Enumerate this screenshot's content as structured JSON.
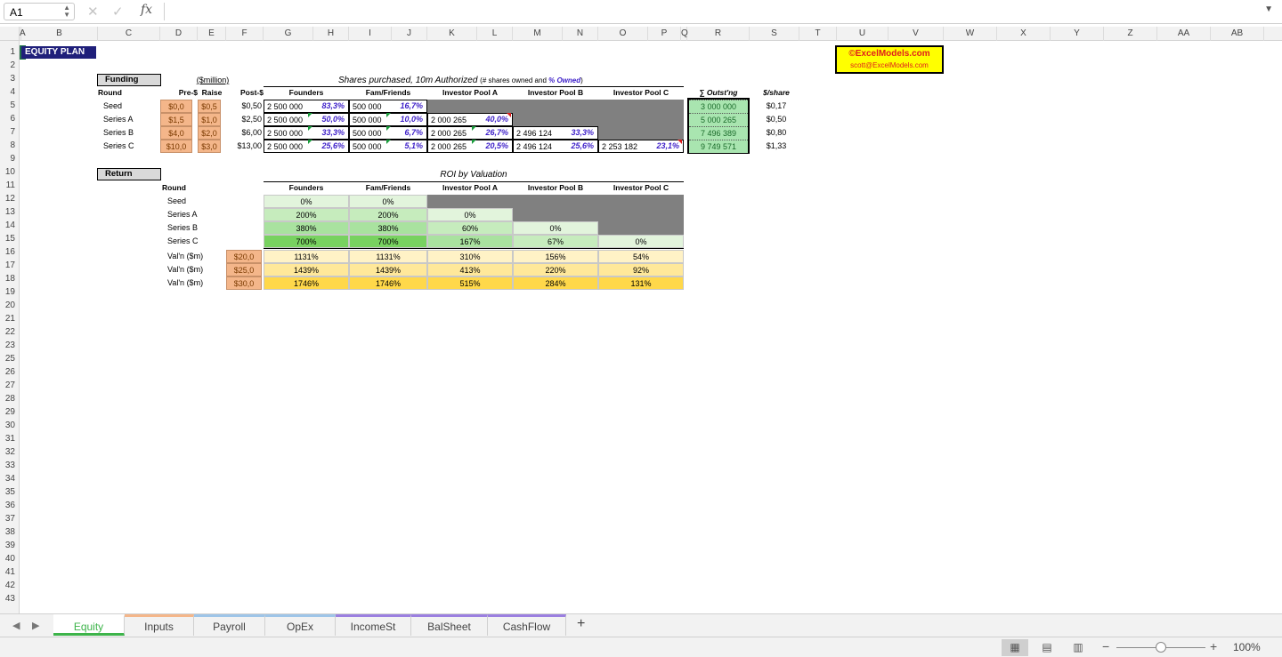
{
  "formula_bar": {
    "cell_ref": "A1",
    "fx_label": "fx",
    "formula": ""
  },
  "columns": [
    "A",
    "B",
    "C",
    "D",
    "E",
    "F",
    "G",
    "H",
    "I",
    "J",
    "K",
    "L",
    "M",
    "N",
    "O",
    "P",
    "Q",
    "R",
    "S",
    "T",
    "U",
    "V",
    "W",
    "X",
    "Y",
    "Z",
    "AA",
    "AB"
  ],
  "rows": [
    "1",
    "2",
    "3",
    "4",
    "5",
    "6",
    "7",
    "8",
    "9",
    "10",
    "11",
    "12",
    "13",
    "14",
    "15",
    "16",
    "17",
    "18",
    "19",
    "20",
    "21",
    "22",
    "23",
    "25",
    "26",
    "27",
    "28",
    "29",
    "30",
    "31",
    "32",
    "33",
    "34",
    "35",
    "36",
    "37",
    "38",
    "39",
    "40",
    "41",
    "42",
    "43"
  ],
  "title": "EQUITY PLAN",
  "logo": {
    "line1": "©ExcelModels.com",
    "line2": "scott@ExcelModels.com"
  },
  "funding": {
    "label": "Funding",
    "unit": "($million)",
    "shares_title": "Shares purchased,  10m Authorized",
    "shares_note": "(# shares owned and ",
    "shares_note_pct": "% Owned",
    "shares_note_end": ")",
    "headers": {
      "round": "Round",
      "pre": "Pre-$",
      "raise": "Raise",
      "post": "Post-$",
      "founders": "Founders",
      "fam": "Fam/Friends",
      "pool_a": "Investor Pool A",
      "pool_b": "Investor Pool B",
      "pool_c": "Investor Pool C",
      "outst": "∑ Outst'ng",
      "per_share": "$/share"
    },
    "rows": [
      {
        "round": "Seed",
        "pre": "$0,0",
        "raise": "$0,5",
        "post": "$0,50",
        "founders": "2 500 000",
        "founders_pct": "83,3%",
        "fam": "500 000",
        "fam_pct": "16,7%",
        "pool_a": "",
        "pool_a_pct": "",
        "pool_b": "",
        "pool_b_pct": "",
        "pool_c": "",
        "pool_c_pct": "",
        "outst": "3 000 000",
        "per_share": "$0,17"
      },
      {
        "round": "Series A",
        "pre": "$1,5",
        "raise": "$1,0",
        "post": "$2,50",
        "founders": "2 500 000",
        "founders_pct": "50,0%",
        "fam": "500 000",
        "fam_pct": "10,0%",
        "pool_a": "2 000 265",
        "pool_a_pct": "40,0%",
        "pool_b": "",
        "pool_b_pct": "",
        "pool_c": "",
        "pool_c_pct": "",
        "outst": "5 000 265",
        "per_share": "$0,50"
      },
      {
        "round": "Series B",
        "pre": "$4,0",
        "raise": "$2,0",
        "post": "$6,00",
        "founders": "2 500 000",
        "founders_pct": "33,3%",
        "fam": "500 000",
        "fam_pct": "6,7%",
        "pool_a": "2 000 265",
        "pool_a_pct": "26,7%",
        "pool_b": "2 496 124",
        "pool_b_pct": "33,3%",
        "pool_c": "",
        "pool_c_pct": "",
        "outst": "7 496 389",
        "per_share": "$0,80"
      },
      {
        "round": "Series C",
        "pre": "$10,0",
        "raise": "$3,0",
        "post": "$13,00",
        "founders": "2 500 000",
        "founders_pct": "25,6%",
        "fam": "500 000",
        "fam_pct": "5,1%",
        "pool_a": "2 000 265",
        "pool_a_pct": "20,5%",
        "pool_b": "2 496 124",
        "pool_b_pct": "25,6%",
        "pool_c": "2 253 182",
        "pool_c_pct": "23,1%",
        "outst": "9 749 571",
        "per_share": "$1,33"
      }
    ]
  },
  "returns": {
    "label": "Return",
    "roi_title": "ROI by Valuation",
    "headers": {
      "round": "Round",
      "founders": "Founders",
      "fam": "Fam/Friends",
      "pool_a": "Investor Pool A",
      "pool_b": "Investor Pool B",
      "pool_c": "Investor Pool C"
    },
    "rounds": [
      {
        "round": "Seed",
        "founders": "0%",
        "fam": "0%",
        "pool_a": "",
        "pool_b": "",
        "pool_c": ""
      },
      {
        "round": "Series A",
        "founders": "200%",
        "fam": "200%",
        "pool_a": "0%",
        "pool_b": "",
        "pool_c": ""
      },
      {
        "round": "Series B",
        "founders": "380%",
        "fam": "380%",
        "pool_a": "60%",
        "pool_b": "0%",
        "pool_c": ""
      },
      {
        "round": "Series C",
        "founders": "700%",
        "fam": "700%",
        "pool_a": "167%",
        "pool_b": "67%",
        "pool_c": "0%"
      }
    ],
    "valuations": [
      {
        "label": "Val'n ($m)",
        "value": "$20,0",
        "founders": "1131%",
        "fam": "1131%",
        "pool_a": "310%",
        "pool_b": "156%",
        "pool_c": "54%"
      },
      {
        "label": "Val'n ($m)",
        "value": "$25,0",
        "founders": "1439%",
        "fam": "1439%",
        "pool_a": "413%",
        "pool_b": "220%",
        "pool_c": "92%"
      },
      {
        "label": "Val'n ($m)",
        "value": "$30,0",
        "founders": "1746%",
        "fam": "1746%",
        "pool_a": "515%",
        "pool_b": "284%",
        "pool_c": "131%"
      }
    ]
  },
  "tabs": [
    "Equity",
    "Inputs",
    "Payroll",
    "OpEx",
    "IncomeSt",
    "BalSheet",
    "CashFlow"
  ],
  "tab_colors": [
    "#3db44a",
    "#f4b68a",
    "#9ec5e8",
    "#9ec5e8",
    "#9b7fe0",
    "#9b7fe0",
    "#9b7fe0"
  ],
  "active_tab": "Equity",
  "zoom": "100%",
  "colors": {
    "roi_green": [
      "#e2f4dc",
      "#c6ecbd",
      "#a9e29f",
      "#78d260"
    ],
    "roi_yellow": [
      "#fff2c6",
      "#ffe89a",
      "#ffd84a"
    ]
  }
}
